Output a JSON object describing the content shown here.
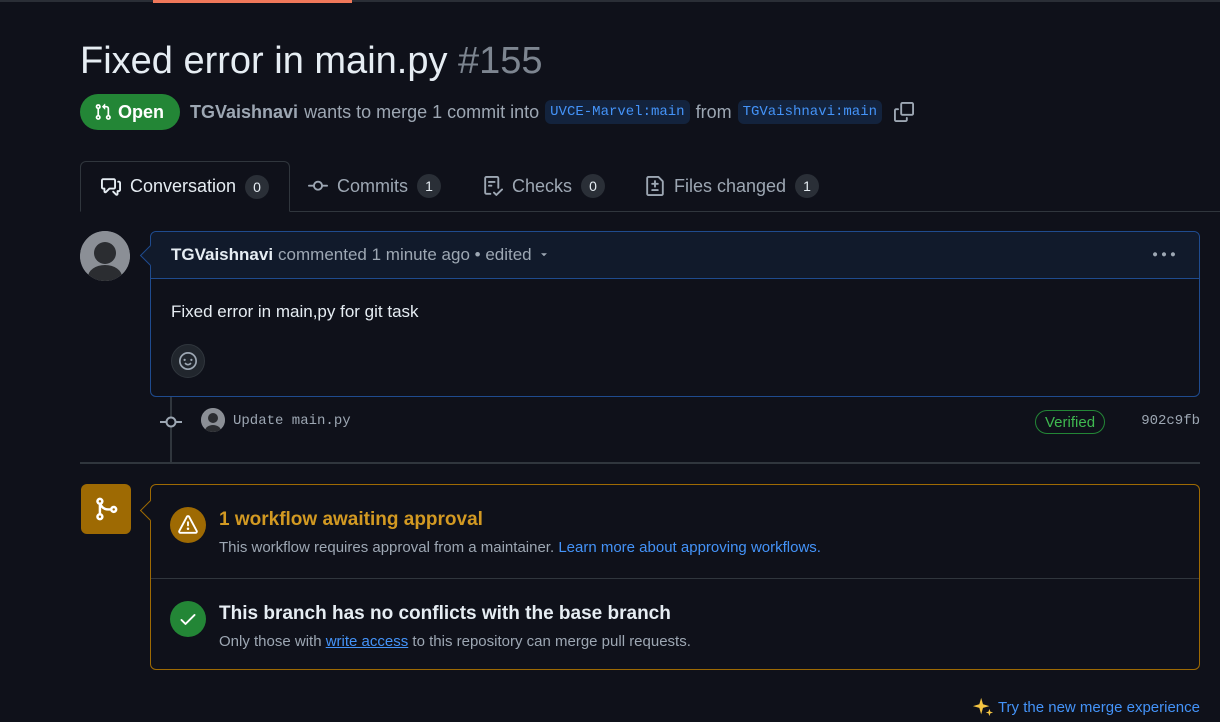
{
  "pr": {
    "title": "Fixed error in main.py",
    "number": "#155",
    "state": "Open",
    "author": "TGVaishnavi",
    "merge_text": "wants to merge 1 commit into",
    "base_branch": "UVCE-Marvel:main",
    "from_text": "from",
    "head_branch": "TGVaishnavi:main"
  },
  "tabs": [
    {
      "label": "Conversation",
      "count": "0",
      "icon": "comment-discussion-icon"
    },
    {
      "label": "Commits",
      "count": "1",
      "icon": "git-commit-icon"
    },
    {
      "label": "Checks",
      "count": "0",
      "icon": "checklist-icon"
    },
    {
      "label": "Files changed",
      "count": "1",
      "icon": "file-diff-icon"
    }
  ],
  "comment": {
    "author": "TGVaishnavi",
    "action": "commented",
    "time": "1 minute ago",
    "edited": "• edited",
    "body": "Fixed error in main,py for git task"
  },
  "commit": {
    "message": "Update main.py",
    "verified_label": "Verified",
    "sha": "902c9fb"
  },
  "merge": {
    "workflow_title": "1 workflow awaiting approval",
    "workflow_desc": "This workflow requires approval from a maintainer.",
    "workflow_link": "Learn more about approving workflows.",
    "conflicts_title": "This branch has no conflicts with the base branch",
    "conflicts_desc_before": "Only those with",
    "conflicts_link": "write access",
    "conflicts_desc_after": "to this repository can merge pull requests."
  },
  "footer": {
    "try_new": "Try the new merge experience"
  },
  "colors": {
    "open_green": "#238636",
    "link_blue": "#4493f8",
    "warning_amber": "#9e6a03",
    "warning_text": "#d29922"
  }
}
